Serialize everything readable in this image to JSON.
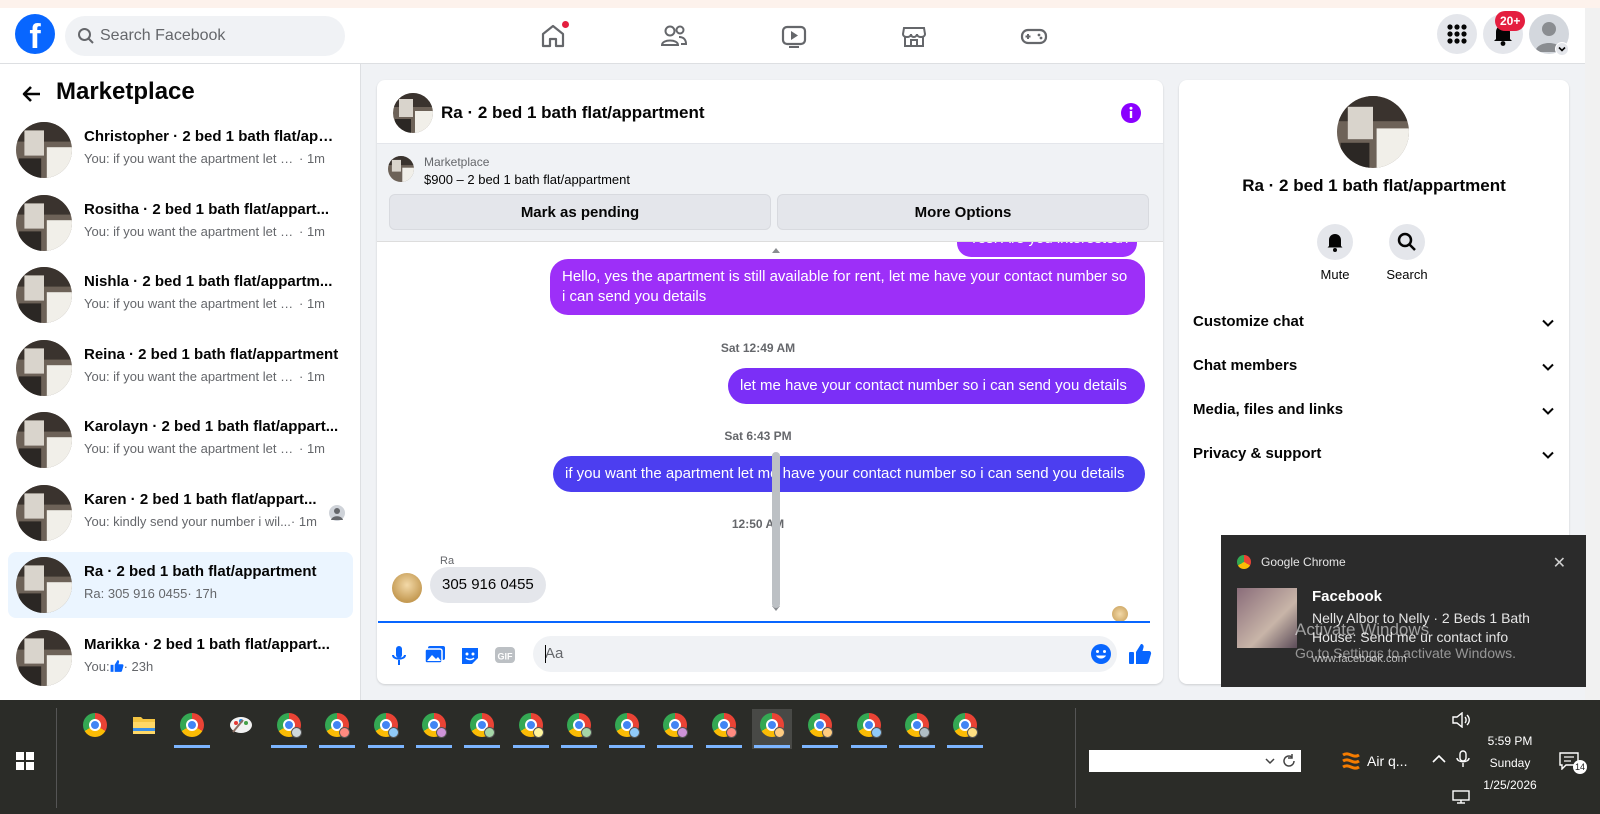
{
  "topbar": {
    "logo_letter": "f",
    "search_placeholder": "Search Facebook",
    "nav": [
      "home-icon",
      "friends-icon",
      "video-icon",
      "marketplace-icon",
      "gaming-icon"
    ],
    "notifications_badge": "20+"
  },
  "sidebar": {
    "title": "Marketplace",
    "conversations": [
      {
        "name": "Christopher · 2 bed 1 bath flat/app...",
        "preview": "You: if you want the apartment let m...",
        "time": "· 1m"
      },
      {
        "name": "Rositha · 2 bed 1 bath flat/appart...",
        "preview": "You: if you want the apartment let m...",
        "time": "· 1m"
      },
      {
        "name": "Nishla · 2 bed 1 bath flat/appartm...",
        "preview": "You: if you want the apartment let m...",
        "time": "· 1m"
      },
      {
        "name": "Reina · 2 bed 1 bath flat/appartment",
        "preview": "You: if you want the apartment let m...",
        "time": "· 1m"
      },
      {
        "name": "Karolayn · 2 bed 1 bath flat/appart...",
        "preview": "You: if you want the apartment let m...",
        "time": "· 1m"
      },
      {
        "name": "Karen · 2 bed 1 bath flat/appart...",
        "preview": "You: kindly send your number i wil...",
        "time": "· 1m"
      },
      {
        "name": "Ra · 2 bed 1 bath flat/appartment",
        "preview": "Ra: 305 916 0455",
        "time": "· 17h"
      },
      {
        "name": "Marikka · 2 bed 1 bath flat/appart...",
        "preview": "You: ",
        "time": "· 23h"
      }
    ]
  },
  "chat": {
    "title": "Ra · 2 bed 1 bath flat/appartment",
    "listing_source": "Marketplace",
    "listing_price": "$900 – 2 bed 1 bath flat/appartment",
    "mark_pending": "Mark as pending",
    "more_options": "More Options",
    "cut_message": "Yes. Are you interested?",
    "msg1": "Hello, yes the apartment is still available for rent, let me have your contact number so i can send you details",
    "ts1": "Sat 12:49 AM",
    "msg2": "let me have your contact number so i can send you details",
    "ts2": "Sat 6:43 PM",
    "msg3": "if you want the apartment let me have your contact number so i can send you details",
    "ts3": "12:50 AM",
    "sender": "Ra",
    "reply": "305 916 0455",
    "composer_placeholder": "Aa"
  },
  "info_panel": {
    "title": "Ra · 2 bed 1 bath flat/appartment",
    "mute": "Mute",
    "search": "Search",
    "sections": [
      "Customize chat",
      "Chat members",
      "Media, files and links",
      "Privacy & support"
    ]
  },
  "toast": {
    "app": "Google Chrome",
    "close": "✕",
    "title": "Facebook",
    "body": "Nelly Albor to Nelly · 2 Beds 1 Bath House: Send me ur contact info",
    "url": "www.facebook.com",
    "watermark_title": "Activate Windows",
    "watermark_sub": "Go to Settings to activate Windows."
  },
  "taskbar": {
    "tray_text": "Air q...",
    "time": "5:59 PM",
    "day": "Sunday",
    "date": "1/25/2026",
    "notification_count": "14"
  },
  "colors": {
    "brand": "#0866ff",
    "bubble_purple": "#a033ff",
    "bubble_violet": "#7b2ff7",
    "bubble_indigo": "#4c3ef0"
  }
}
